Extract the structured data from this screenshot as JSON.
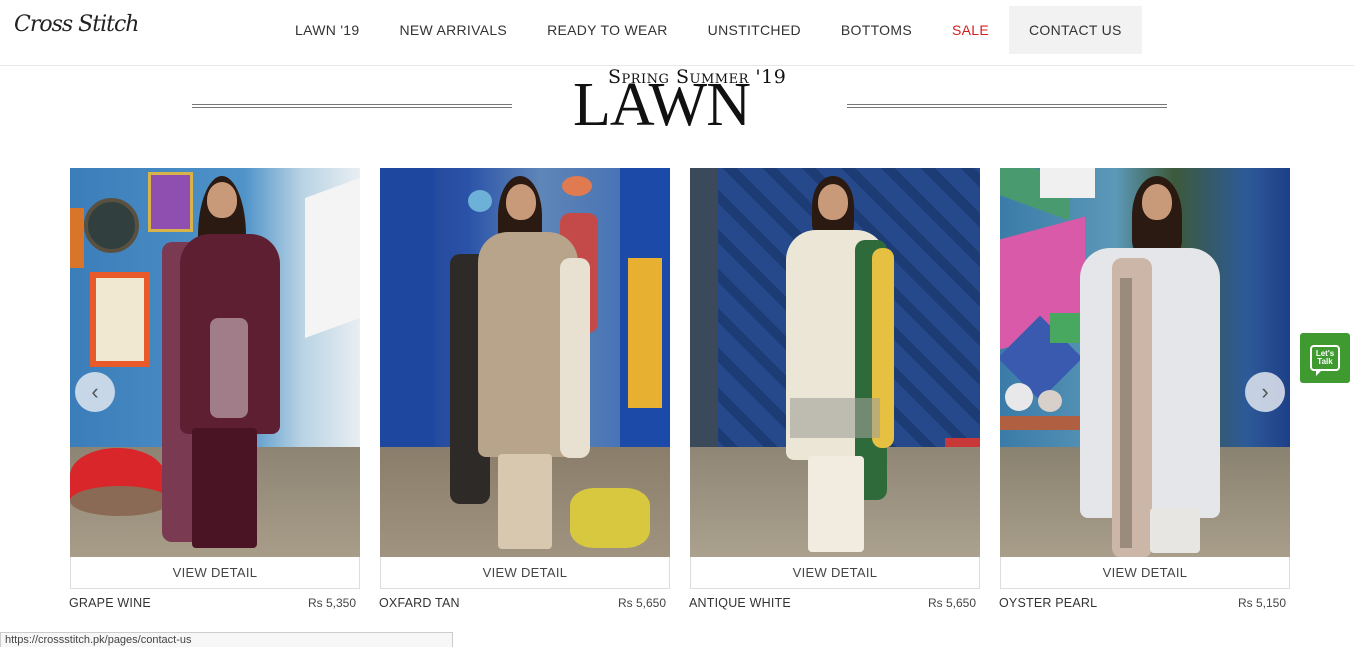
{
  "header": {
    "logo": "Cross Stitch",
    "nav": [
      {
        "label": "LAWN '19"
      },
      {
        "label": "NEW ARRIVALS"
      },
      {
        "label": "READY TO WEAR"
      },
      {
        "label": "UNSTITCHED"
      },
      {
        "label": "BOTTOMS"
      },
      {
        "label": "SALE"
      },
      {
        "label": "CONTACT US"
      }
    ]
  },
  "banner": {
    "subtitle": "Spring Summer '19",
    "title": "LAWN"
  },
  "products": [
    {
      "name": "GRAPE WINE",
      "price": "Rs 5,350",
      "action": "VIEW DETAIL",
      "dress_color": "#5e1f33",
      "bg_color": "#3d7fb8"
    },
    {
      "name": "OXFARD TAN",
      "price": "Rs 5,650",
      "action": "VIEW DETAIL",
      "dress_color": "#b7a48a",
      "bg_color": "#2a4fa0"
    },
    {
      "name": "ANTIQUE WHITE",
      "price": "Rs 5,650",
      "action": "VIEW DETAIL",
      "dress_color": "#ece6d6",
      "bg_color": "#274d8e"
    },
    {
      "name": "OYSTER PEARL",
      "price": "Rs 5,150",
      "action": "VIEW DETAIL",
      "dress_color": "#e4e6ea",
      "bg_color": "#4a86a8"
    }
  ],
  "carousel": {
    "prev_icon": "chevron-left-icon",
    "next_icon": "chevron-right-icon"
  },
  "chat_widget": {
    "label": "Let's Talk",
    "icon": "chat-bubble-icon",
    "color": "#3f9a2f"
  },
  "status_bar": {
    "url": "https://crossstitch.pk/pages/contact-us"
  }
}
